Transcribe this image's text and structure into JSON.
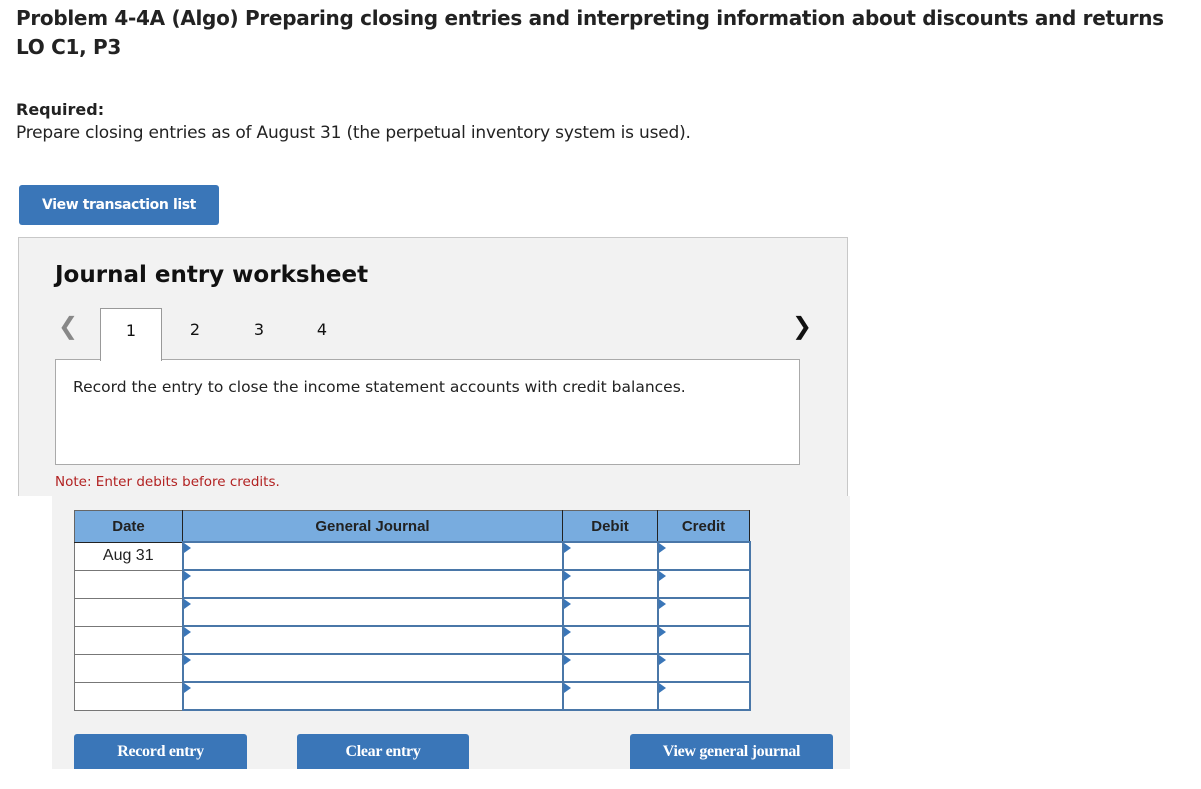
{
  "header": {
    "title_line1": "Problem 4-4A (Algo) Preparing closing entries and interpreting information about discounts and returns",
    "title_line2": "LO C1, P3",
    "required_label": "Required:",
    "required_text": "Prepare closing entries as of August 31 (the perpetual inventory system is used)."
  },
  "buttons": {
    "view_transaction_list": "View transaction list",
    "record_entry": "Record entry",
    "clear_entry": "Clear entry",
    "view_general_journal": "View general journal"
  },
  "worksheet": {
    "title": "Journal entry worksheet",
    "prev_icon": "chevron-left-icon",
    "next_icon": "chevron-right-icon",
    "tabs": [
      {
        "label": "1",
        "active": true
      },
      {
        "label": "2",
        "active": false
      },
      {
        "label": "3",
        "active": false
      },
      {
        "label": "4",
        "active": false
      }
    ],
    "instruction": "Record the entry to close the income statement accounts with credit balances.",
    "note": "Note: Enter debits before credits."
  },
  "journal": {
    "columns": [
      "Date",
      "General Journal",
      "Debit",
      "Credit"
    ],
    "rows": [
      {
        "date": "Aug 31",
        "account": "",
        "debit": "",
        "credit": ""
      },
      {
        "date": "",
        "account": "",
        "debit": "",
        "credit": ""
      },
      {
        "date": "",
        "account": "",
        "debit": "",
        "credit": ""
      },
      {
        "date": "",
        "account": "",
        "debit": "",
        "credit": ""
      },
      {
        "date": "",
        "account": "",
        "debit": "",
        "credit": ""
      },
      {
        "date": "",
        "account": "",
        "debit": "",
        "credit": ""
      }
    ]
  },
  "colors": {
    "button_blue": "#3a76b8",
    "header_blue": "#78acdf",
    "note_red": "#b22222",
    "panel_gray": "#f2f2f2"
  }
}
